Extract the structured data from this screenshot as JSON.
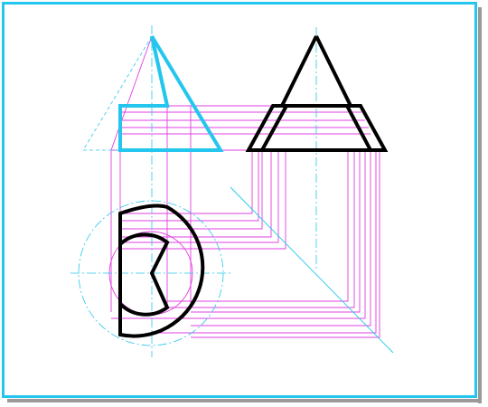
{
  "colors": {
    "background": "#ffffff",
    "frame": "#25C6EE",
    "shadow": "#9a9a9a",
    "construction": "#E040E0",
    "centerline": "#25C6EE",
    "front_view": "#25C6EE",
    "outline": "#000000"
  },
  "views": [
    "front-view-cone",
    "side-view-cone",
    "top-view-circle",
    "miter-line"
  ]
}
